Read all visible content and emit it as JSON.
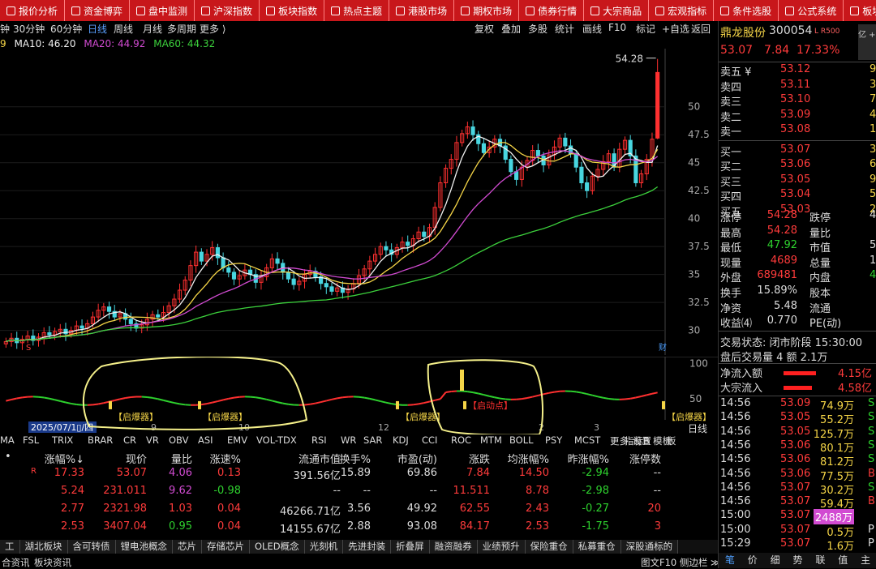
{
  "topbar": [
    "报价分析",
    "资金博弈",
    "盘中监测",
    "沪深指数",
    "板块指数",
    "热点主题",
    "港股市场",
    "期权市场",
    "债券行情",
    "大宗商品",
    "宏观指标",
    "条件选股",
    "公式系统",
    "板块"
  ],
  "toolbar": {
    "periods": [
      "钟",
      "30分钟",
      "60分钟",
      "日线",
      "周线",
      "月线",
      "多周期",
      "更多 ⟩"
    ],
    "selected": "日线",
    "right": [
      "复权",
      "叠加",
      "多股",
      "统计",
      "画线",
      "F10",
      "标记",
      "+自选",
      "返回"
    ]
  },
  "ma": {
    "prefix": "9",
    "ma10": "MA10: 46.20",
    "ma20": "MA20: 44.92",
    "ma60": "MA60: 44.32"
  },
  "chart_data": {
    "type": "candlestick",
    "price_axis_ticks": [
      50.0,
      47.5,
      45.0,
      42.5,
      40.0,
      37.5,
      35.0,
      32.5,
      30.0
    ],
    "ylim": [
      27.8,
      55.2
    ],
    "high_label": "54.28",
    "bottom_marker": "财",
    "closes": [
      29.0,
      29.3,
      28.9,
      29.2,
      29.5,
      29.1,
      29.4,
      29.8,
      29.6,
      29.9,
      30.1,
      29.7,
      30.0,
      30.4,
      30.2,
      30.6,
      31.2,
      31.8,
      32.1,
      31.7,
      31.2,
      31.5,
      31.0,
      30.6,
      30.2,
      30.5,
      31.0,
      31.4,
      31.2,
      31.6,
      32.2,
      32.8,
      33.6,
      34.5,
      35.8,
      37.0,
      36.2,
      36.8,
      37.4,
      36.5,
      35.6,
      35.2,
      34.6,
      34.9,
      35.4,
      35.0,
      34.3,
      34.8,
      35.6,
      36.4,
      36.0,
      35.2,
      34.6,
      34.1,
      34.4,
      35.0,
      35.3,
      34.8,
      34.2,
      33.9,
      33.5,
      33.8,
      33.4,
      33.7,
      34.2,
      34.9,
      35.5,
      36.2,
      36.8,
      37.5,
      37.2,
      36.8,
      37.4,
      37.9,
      37.6,
      38.2,
      38.8,
      38.4,
      39.2,
      41.0,
      43.2,
      44.5,
      45.3,
      46.8,
      47.6,
      48.2,
      47.5,
      46.7,
      45.9,
      46.4,
      47.1,
      46.5,
      45.3,
      44.2,
      43.5,
      44.6,
      45.2,
      46.1,
      45.6,
      44.8,
      45.7,
      46.4,
      47.2,
      46.5,
      45.8,
      44.6,
      43.2,
      42.5,
      43.8,
      44.4,
      45.1,
      45.8,
      44.6,
      46.2,
      47.0,
      45.6,
      43.2,
      44.0,
      45.3,
      47.1
    ],
    "last_candle": {
      "open": 47.2,
      "close": 53.07,
      "high": 54.28,
      "low": 47.1
    },
    "indicator": {
      "ylim": [
        20,
        110
      ],
      "ticks": [
        100.0,
        50.0
      ],
      "signal_tags": [
        {
          "text": "【启爆器】"
        },
        {
          "text": "【启爆器】"
        },
        {
          "text": "【启爆器】"
        },
        {
          "text": "【启动点】"
        },
        {
          "text": "【启爆器】"
        }
      ],
      "date_label": "2025/07/1▯/四",
      "month_labels": [
        "9",
        "10",
        "12",
        "2",
        "3"
      ],
      "right_label": "日线"
    }
  },
  "subbar": {
    "items": [
      "MA",
      "FSL",
      "TRIX",
      "BRAR",
      "CR",
      "VR",
      "OBV",
      "ASI",
      "EMV",
      "VOL-TDX",
      "RSI",
      "WR",
      "SAR",
      "KDJ",
      "CCI",
      "ROC",
      "MTM",
      "BOLL",
      "PSY",
      "MCST",
      "更多",
      "设置"
    ],
    "right": [
      "指标B",
      "模板",
      "板"
    ]
  },
  "table": {
    "headers": [
      "涨幅%↓",
      "现价",
      "量比",
      "涨速%",
      "流通市值",
      "换手%",
      "市盈(动)",
      "涨跌",
      "均涨幅%",
      "昨涨幅%",
      "涨停数"
    ],
    "rows": [
      {
        "mark": "R",
        "v": [
          "17.33",
          "53.07",
          "4.06",
          "0.13",
          "391.56亿",
          "15.89",
          "69.86",
          "7.84",
          "14.50",
          "-2.94",
          "--"
        ]
      },
      {
        "mark": "",
        "v": [
          "5.24",
          "231.011",
          "9.62",
          "-0.98",
          "--",
          "--",
          "--",
          "11.511",
          "8.78",
          "-2.98",
          "--"
        ]
      },
      {
        "mark": "",
        "v": [
          "2.77",
          "2321.98",
          "1.03",
          "0.04",
          "46266.71亿",
          "3.56",
          "49.92",
          "62.55",
          "2.43",
          "-0.27",
          "20"
        ]
      },
      {
        "mark": "",
        "v": [
          "2.53",
          "3407.04",
          "0.95",
          "0.04",
          "14155.67亿",
          "2.88",
          "93.08",
          "84.17",
          "2.53",
          "-1.75",
          "3"
        ]
      }
    ]
  },
  "tabs": [
    "工",
    "湖北板块",
    "含可转债",
    "锂电池概念",
    "芯片",
    "存储芯片",
    "OLED概念",
    "光刻机",
    "先进封装",
    "折叠屏",
    "融资融券",
    "业绩预升",
    "保险重仓",
    "私募重仓",
    "深股通标的"
  ],
  "footer": {
    "left": [
      "合资讯",
      "板块资讯"
    ],
    "right": "图文F10 侧边栏 ≫"
  },
  "stock": {
    "name": "鼎龙股份",
    "code": "300054",
    "tag": "L R500",
    "price": "53.07",
    "change": "7.84",
    "pct": "17.33%",
    "corner": "亿 +2"
  },
  "orderbook": {
    "asks": [
      {
        "l": "卖五 ¥",
        "p": "53.12",
        "v": "9"
      },
      {
        "l": "卖四",
        "p": "53.11",
        "v": "3"
      },
      {
        "l": "卖三",
        "p": "53.10",
        "v": "7"
      },
      {
        "l": "卖二",
        "p": "53.09",
        "v": "4"
      },
      {
        "l": "卖一",
        "p": "53.08",
        "v": "17"
      }
    ],
    "bids": [
      {
        "l": "买一",
        "p": "53.07",
        "v": "36"
      },
      {
        "l": "买二",
        "p": "53.06",
        "v": "6"
      },
      {
        "l": "买三",
        "p": "53.05",
        "v": "9"
      },
      {
        "l": "买四",
        "p": "53.04",
        "v": "5"
      },
      {
        "l": "买五",
        "p": "53.03",
        "v": "2"
      }
    ]
  },
  "stats": [
    {
      "k1": "涨停",
      "v1": "54.28",
      "k2": "跌停",
      "v2": "4"
    },
    {
      "k1": "最高",
      "v1": "54.28",
      "k2": "量比",
      "v2": ""
    },
    {
      "k1": "最低",
      "v1": "47.92",
      "k2": "市值",
      "v2": "5"
    },
    {
      "k1": "现量",
      "v1": "4689",
      "k2": "总量",
      "v2": "1"
    },
    {
      "k1": "外盘",
      "v1": "689481",
      "k2": "内盘",
      "v2": "4"
    },
    {
      "k1": "换手",
      "v1": "15.89%",
      "k2": "股本",
      "v2": ""
    },
    {
      "k1": "净资",
      "v1": "5.48",
      "k2": "流通",
      "v2": ""
    },
    {
      "k1": "收益⑷",
      "v1": "0.770",
      "k2": "PE(动)",
      "v2": ""
    }
  ],
  "trade_status": "交易状态: 闭市阶段 15:30:00",
  "after_hours": "盘后交易量 4 额 2.1万",
  "flows": [
    {
      "label": "净流入额",
      "value": "4.15亿",
      "bar": 0.8
    },
    {
      "label": "大宗流入",
      "value": "4.58亿",
      "bar": 0.7
    }
  ],
  "ticks": [
    {
      "t": "14:56",
      "p": "53.09",
      "v": "74.9万",
      "d": "S"
    },
    {
      "t": "14:56",
      "p": "53.05",
      "v": "55.2万",
      "d": "S"
    },
    {
      "t": "14:56",
      "p": "53.05",
      "v": "125.7万",
      "d": "S"
    },
    {
      "t": "14:56",
      "p": "53.06",
      "v": "80.1万",
      "d": "S"
    },
    {
      "t": "14:56",
      "p": "53.06",
      "v": "81.2万",
      "d": "S"
    },
    {
      "t": "14:56",
      "p": "53.06",
      "v": "77.5万",
      "d": "B"
    },
    {
      "t": "14:56",
      "p": "53.07",
      "v": "30.2万",
      "d": "S"
    },
    {
      "t": "14:56",
      "p": "53.07",
      "v": "59.4万",
      "d": "B"
    },
    {
      "t": "15:00",
      "p": "53.07",
      "v": "2488万",
      "d": ""
    },
    {
      "t": "15:00",
      "p": "53.07",
      "v": "0.5万",
      "d": "P"
    },
    {
      "t": "15:29",
      "p": "53.07",
      "v": "1.6万",
      "d": "P"
    }
  ],
  "bottom_tabs": [
    "笔",
    "价",
    "细",
    "势",
    "联",
    "值",
    "主"
  ]
}
